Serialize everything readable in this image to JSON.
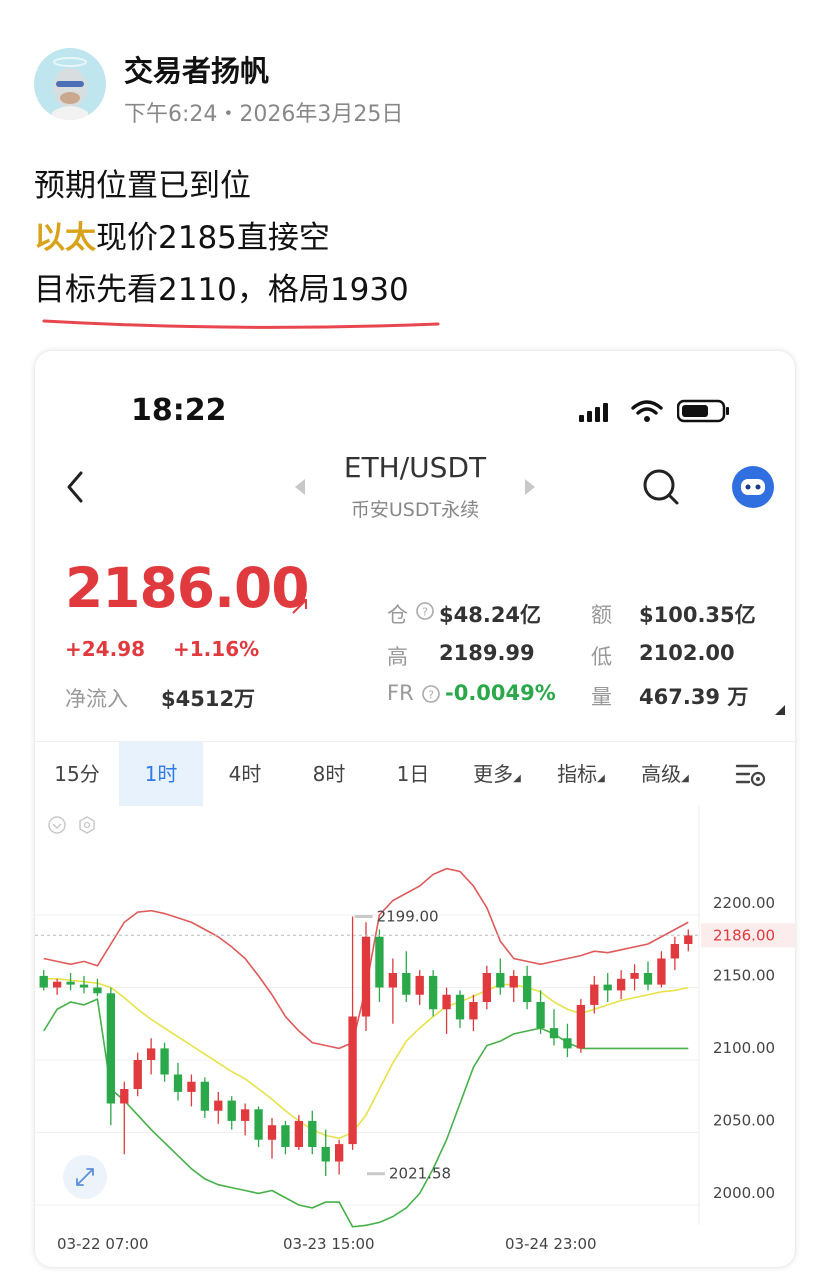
{
  "post": {
    "author": "交易者扬帆",
    "meta": "下午6:24・2026年3月25日",
    "line1": "预期位置已到位",
    "line2_highlight": "以太",
    "line2_rest": "现价2185直接空",
    "line3": "目标先看2110，格局1930"
  },
  "phone": {
    "time": "18:22",
    "pair": "ETH/USDT",
    "exchange": "币安USDT永续",
    "price": "2186.00",
    "change_abs": "+24.98",
    "change_pct": "+1.16%",
    "netflow_label": "净流入",
    "netflow_value": "$4512万",
    "stats": [
      {
        "label": "仓",
        "value": "$48.24亿"
      },
      {
        "label": "额",
        "value": "$100.35亿"
      },
      {
        "label": "高",
        "value": "2189.99"
      },
      {
        "label": "低",
        "value": "2102.00"
      },
      {
        "label": "FR",
        "value": "-0.0049%"
      },
      {
        "label": "量",
        "value": "467.39 万"
      }
    ],
    "tabs": [
      "15分",
      "1时",
      "4时",
      "8时",
      "1日",
      "更多",
      "指标",
      "高级"
    ],
    "active_tab": "1时"
  },
  "chart_data": {
    "type": "candlestick",
    "x_tick_labels": [
      "03-22 07:00",
      "03-23 15:00",
      "03-24 23:00"
    ],
    "y_tick_labels": [
      "2200.00",
      "2150.00",
      "2100.00",
      "2050.00",
      "2000.00"
    ],
    "ylim": [
      1985,
      2240
    ],
    "current_price_label": "2186.00",
    "annotations": [
      {
        "text": "2199.00",
        "value": 2199.0
      },
      {
        "text": "2021.58",
        "value": 2021.58
      }
    ],
    "up_color": "#e0393e",
    "down_color": "#2aa84a",
    "bollinger": {
      "upper": [
        2170,
        2168,
        2166,
        2168,
        2165,
        2180,
        2195,
        2202,
        2203,
        2201,
        2198,
        2195,
        2190,
        2185,
        2178,
        2170,
        2158,
        2145,
        2130,
        2120,
        2112,
        2110,
        2108,
        2112,
        2150,
        2200,
        2210,
        2215,
        2220,
        2228,
        2232,
        2230,
        2220,
        2205,
        2182,
        2170,
        2168,
        2166,
        2168,
        2170,
        2172,
        2175,
        2174,
        2176,
        2178,
        2180,
        2185,
        2190,
        2195
      ],
      "middle": [
        2156,
        2156,
        2155,
        2154,
        2153,
        2150,
        2143,
        2135,
        2128,
        2122,
        2116,
        2110,
        2104,
        2098,
        2092,
        2087,
        2080,
        2073,
        2065,
        2058,
        2052,
        2048,
        2046,
        2050,
        2062,
        2080,
        2098,
        2113,
        2122,
        2130,
        2137,
        2140,
        2144,
        2148,
        2152,
        2152,
        2150,
        2147,
        2140,
        2135,
        2132,
        2135,
        2138,
        2141,
        2143,
        2145,
        2147,
        2148,
        2150
      ],
      "lower": [
        2120,
        2135,
        2140,
        2138,
        2142,
        2080,
        2072,
        2062,
        2052,
        2043,
        2034,
        2025,
        2018,
        2014,
        2012,
        2010,
        2008,
        2010,
        2005,
        2000,
        1998,
        2002,
        2002,
        1985,
        1986,
        1988,
        1992,
        1998,
        2008,
        2025,
        2045,
        2070,
        2095,
        2110,
        2113,
        2118,
        2120,
        2122,
        2118,
        2112,
        2108,
        2108,
        2108,
        2108,
        2108,
        2108,
        2108,
        2108,
        2108
      ]
    },
    "candles": [
      {
        "o": 2158,
        "h": 2162,
        "l": 2148,
        "c": 2150
      },
      {
        "o": 2150,
        "h": 2156,
        "l": 2145,
        "c": 2154
      },
      {
        "o": 2154,
        "h": 2160,
        "l": 2148,
        "c": 2152
      },
      {
        "o": 2152,
        "h": 2158,
        "l": 2146,
        "c": 2150
      },
      {
        "o": 2150,
        "h": 2156,
        "l": 2144,
        "c": 2146
      },
      {
        "o": 2146,
        "h": 2150,
        "l": 2055,
        "c": 2070
      },
      {
        "o": 2070,
        "h": 2085,
        "l": 2035,
        "c": 2080
      },
      {
        "o": 2080,
        "h": 2105,
        "l": 2075,
        "c": 2100
      },
      {
        "o": 2100,
        "h": 2115,
        "l": 2090,
        "c": 2108
      },
      {
        "o": 2108,
        "h": 2112,
        "l": 2085,
        "c": 2090
      },
      {
        "o": 2090,
        "h": 2098,
        "l": 2072,
        "c": 2078
      },
      {
        "o": 2078,
        "h": 2090,
        "l": 2068,
        "c": 2085
      },
      {
        "o": 2085,
        "h": 2088,
        "l": 2060,
        "c": 2065
      },
      {
        "o": 2065,
        "h": 2078,
        "l": 2056,
        "c": 2072
      },
      {
        "o": 2072,
        "h": 2075,
        "l": 2052,
        "c": 2058
      },
      {
        "o": 2058,
        "h": 2070,
        "l": 2048,
        "c": 2066
      },
      {
        "o": 2066,
        "h": 2068,
        "l": 2040,
        "c": 2045
      },
      {
        "o": 2045,
        "h": 2060,
        "l": 2032,
        "c": 2055
      },
      {
        "o": 2055,
        "h": 2058,
        "l": 2035,
        "c": 2040
      },
      {
        "o": 2040,
        "h": 2062,
        "l": 2038,
        "c": 2058
      },
      {
        "o": 2058,
        "h": 2065,
        "l": 2035,
        "c": 2040
      },
      {
        "o": 2040,
        "h": 2052,
        "l": 2020,
        "c": 2030
      },
      {
        "o": 2030,
        "h": 2045,
        "l": 2021,
        "c": 2042
      },
      {
        "o": 2042,
        "h": 2199,
        "l": 2038,
        "c": 2130
      },
      {
        "o": 2130,
        "h": 2195,
        "l": 2120,
        "c": 2185
      },
      {
        "o": 2185,
        "h": 2190,
        "l": 2140,
        "c": 2150
      },
      {
        "o": 2150,
        "h": 2170,
        "l": 2125,
        "c": 2160
      },
      {
        "o": 2160,
        "h": 2175,
        "l": 2140,
        "c": 2145
      },
      {
        "o": 2145,
        "h": 2162,
        "l": 2138,
        "c": 2158
      },
      {
        "o": 2158,
        "h": 2162,
        "l": 2130,
        "c": 2135
      },
      {
        "o": 2135,
        "h": 2150,
        "l": 2118,
        "c": 2145
      },
      {
        "o": 2145,
        "h": 2148,
        "l": 2122,
        "c": 2128
      },
      {
        "o": 2128,
        "h": 2145,
        "l": 2120,
        "c": 2140
      },
      {
        "o": 2140,
        "h": 2165,
        "l": 2135,
        "c": 2160
      },
      {
        "o": 2160,
        "h": 2170,
        "l": 2145,
        "c": 2150
      },
      {
        "o": 2150,
        "h": 2162,
        "l": 2140,
        "c": 2158
      },
      {
        "o": 2158,
        "h": 2165,
        "l": 2135,
        "c": 2140
      },
      {
        "o": 2140,
        "h": 2148,
        "l": 2118,
        "c": 2122
      },
      {
        "o": 2122,
        "h": 2135,
        "l": 2110,
        "c": 2115
      },
      {
        "o": 2115,
        "h": 2125,
        "l": 2102,
        "c": 2108
      },
      {
        "o": 2108,
        "h": 2142,
        "l": 2105,
        "c": 2138
      },
      {
        "o": 2138,
        "h": 2158,
        "l": 2132,
        "c": 2152
      },
      {
        "o": 2152,
        "h": 2160,
        "l": 2140,
        "c": 2148
      },
      {
        "o": 2148,
        "h": 2162,
        "l": 2142,
        "c": 2156
      },
      {
        "o": 2156,
        "h": 2166,
        "l": 2148,
        "c": 2160
      },
      {
        "o": 2160,
        "h": 2168,
        "l": 2148,
        "c": 2152
      },
      {
        "o": 2152,
        "h": 2175,
        "l": 2150,
        "c": 2170
      },
      {
        "o": 2170,
        "h": 2185,
        "l": 2162,
        "c": 2180
      },
      {
        "o": 2180,
        "h": 2190,
        "l": 2175,
        "c": 2186
      }
    ]
  }
}
